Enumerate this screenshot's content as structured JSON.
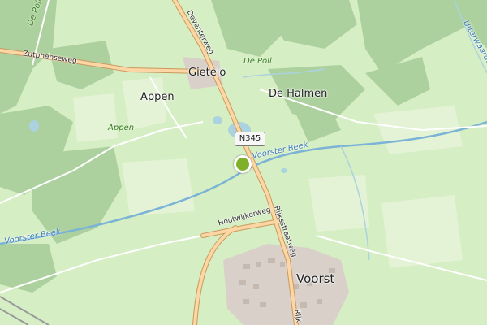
{
  "places": {
    "gietelo": "Gietelo",
    "appen": "Appen",
    "appen_area": "Appen",
    "de_halmen": "De Halmen",
    "voorst": "Voorst"
  },
  "roads": {
    "zutphenseweg": "Zutphenseweg",
    "deventerweg": "Deventerweg",
    "houtwijkerweg": "Houtwijkerweg",
    "rijksstraatweg": "Rijksstraatweg",
    "rijk_partial": "Rijk",
    "n345_ref": "N345"
  },
  "water": {
    "voorster_beek_right": "Voorster Beek",
    "voorster_beek_left": "Voorster Beek",
    "de_poll": "De Poll",
    "de_poll_top": "De Poll",
    "uiterwaarden": "Uiterwaarden"
  },
  "colors": {
    "meadow": "#d6eec4",
    "forest": "#add19e",
    "water": "#aad3df",
    "road_primary": "#fcd6a4",
    "road_casing": "#c99a5c",
    "marker": "#7fb02b",
    "village": "#d9d0c9"
  },
  "marker": {
    "icon": "location-pin-icon"
  }
}
